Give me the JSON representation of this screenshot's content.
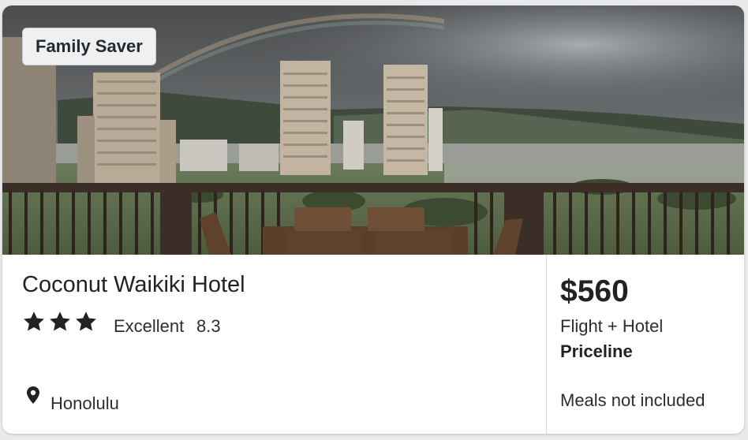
{
  "hotel": {
    "badge": "Family Saver",
    "name": "Coconut Waikiki Hotel",
    "stars": 3,
    "rating_label": "Excellent",
    "rating_score": "8.3",
    "location": "Honolulu",
    "photo_icon": "hotel-balcony-photo",
    "location_icon": "map-pin-icon",
    "star_icon": "star-icon"
  },
  "deal": {
    "price": "$560",
    "package_type": "Flight + Hotel",
    "provider": "Priceline",
    "meals": "Meals not included"
  },
  "colors": {
    "text": "#1f2326",
    "badge_bg": "#eef0f2",
    "card_bg": "#ffffff",
    "page_bg": "#e9eaec"
  }
}
